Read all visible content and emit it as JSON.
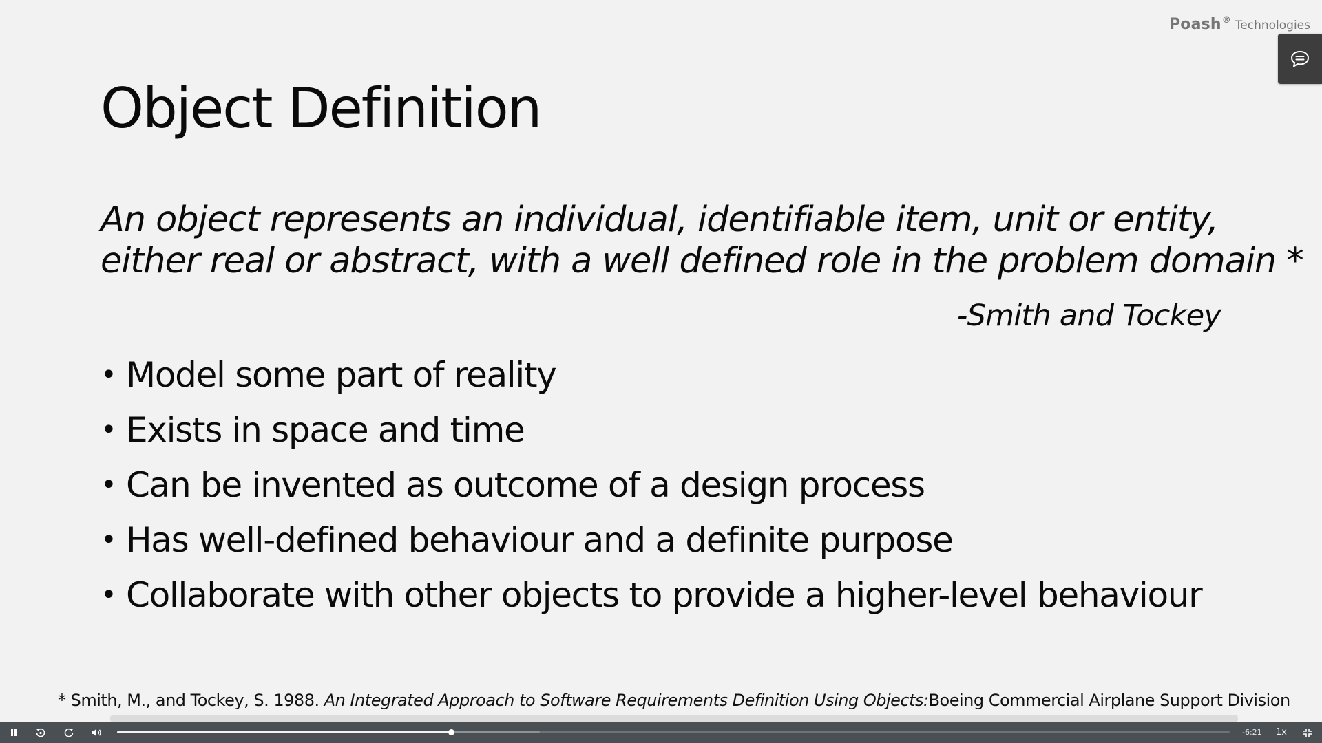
{
  "brand": {
    "name": "Poash",
    "registered": "®",
    "suffix": "Technologies"
  },
  "slide": {
    "title": "Object Definition",
    "quote_lines": [
      "An object represents an individual, identifiable item, unit or entity,",
      "either real or abstract, with a well defined role in the problem domain *"
    ],
    "attribution": "-Smith and Tockey",
    "bullet_char": "•",
    "bullets": [
      "Model some part of reality",
      "Exists in space and time",
      "Can be invented as outcome of a design process",
      "Has well-defined behaviour and a definite purpose",
      "Collaborate with other objects to provide a higher-level behaviour"
    ],
    "footnote": {
      "prefix": "* Smith, M., and Tockey, S. 1988. ",
      "italic": "An Integrated Approach to Software Requirements Definition Using Objects:",
      "suffix": "Boeing Commercial Airplane Support Division"
    }
  },
  "player": {
    "time_remaining": "-6:21",
    "speed": "1x",
    "played_fraction": 0.3,
    "buffered_fraction": 0.38,
    "icons": {
      "play_pause": "pause-icon",
      "rewind": "rewind-icon",
      "forward": "forward-icon",
      "volume": "volume-icon",
      "exit_fullscreen": "exit-fullscreen-icon",
      "chat": "chat-icon"
    }
  },
  "colors": {
    "slide_background": "#f2f2f2",
    "controls_background": "#4a4f54",
    "chat_button": "#3d3d3d",
    "brand_text": "#767676"
  }
}
